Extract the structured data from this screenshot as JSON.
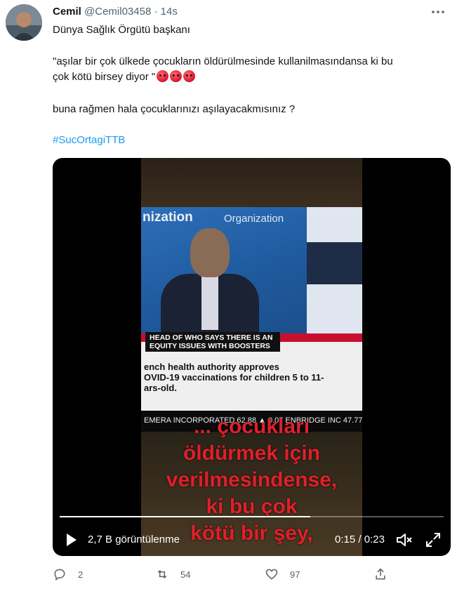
{
  "tweet": {
    "display_name": "Cemil",
    "handle": "@Cemil03458",
    "separator": "·",
    "time": "14s",
    "lines": [
      "Dünya Sağlık Örgütü başkanı",
      " \"aşılar bir çok ülkede çocukların öldürülmesinde kullanilmasındansa ki bu",
      "çok kötü birsey diyor \"",
      "buna rağmen hala çocuklarınızı aşılayacakmısınız ?"
    ],
    "emojis": [
      "angry-face-icon",
      "angry-face-icon",
      "angry-face-icon"
    ],
    "hashtag": "#SucOrtagiTTB"
  },
  "video": {
    "tv_channel_text": "nization",
    "tv_side_text": "Organization",
    "tv_headline": "HEAD OF WHO SAYS THERE IS AN EQUITY ISSUES WITH BOOSTERS",
    "tv_subline_1": "ench health authority approves",
    "tv_subline_2": "OVID-19 vaccinations for children 5 to 11-",
    "tv_subline_3": "ars-old.",
    "tv_ticker": "EMERA INCORPORATED 62.88 ▲ 0.07   ENBRIDGE INC 47.77",
    "captions": [
      "... çocukları",
      "öldürmek için",
      "verilmesindense,",
      "ki bu çok",
      "kötü bir şey,"
    ],
    "progress": 0.652,
    "views": "2,7 B görüntülenme",
    "time_current": "0:15",
    "time_separator": " / ",
    "time_total": "0:23"
  },
  "actions": {
    "reply_count": "2",
    "retweet_count": "54",
    "like_count": "97"
  },
  "colors": {
    "accent": "#1d9bf0",
    "text": "#0f1419",
    "secondary": "#536471",
    "caption_red": "#e0202a"
  }
}
